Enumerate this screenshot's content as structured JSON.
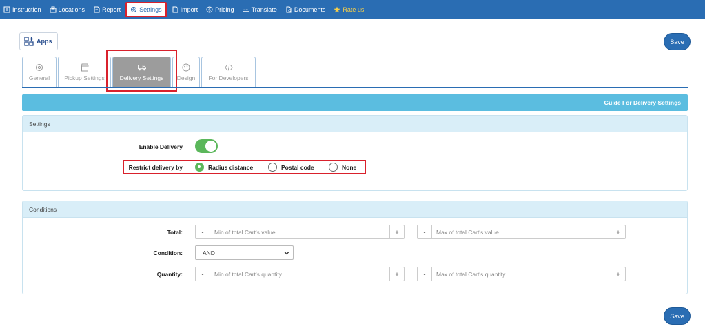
{
  "nav": {
    "items": [
      {
        "label": "Instruction",
        "icon": "instruction-icon"
      },
      {
        "label": "Locations",
        "icon": "locations-icon"
      },
      {
        "label": "Report",
        "icon": "report-icon"
      },
      {
        "label": "Settings",
        "icon": "gear-icon"
      },
      {
        "label": "Import",
        "icon": "import-icon"
      },
      {
        "label": "Pricing",
        "icon": "pricing-icon"
      },
      {
        "label": "Translate",
        "icon": "translate-icon"
      },
      {
        "label": "Documents",
        "icon": "documents-icon"
      },
      {
        "label": "Rate us",
        "icon": "star-icon"
      }
    ]
  },
  "apps_label": "Apps",
  "save_label": "Save",
  "tabs": [
    {
      "label": "General",
      "icon": "gear-icon"
    },
    {
      "label": "Pickup Settings",
      "icon": "store-icon"
    },
    {
      "label": "Delivery Settings",
      "icon": "truck-icon"
    },
    {
      "label": "Design",
      "icon": "palette-icon"
    },
    {
      "label": "For Developers",
      "icon": "code-icon"
    }
  ],
  "guide_label": "Guide For Delivery Settings",
  "settings": {
    "title": "Settings",
    "enable_label": "Enable Delivery",
    "enable_value": true,
    "restrict_label": "Restrict delivery by",
    "options": [
      "Radius distance",
      "Postal code",
      "None"
    ],
    "selected": "Radius distance"
  },
  "conditions": {
    "title": "Conditions",
    "total_label": "Total:",
    "total_min_placeholder": "Min of total Cart's value",
    "total_max_placeholder": "Max of total Cart's value",
    "condition_label": "Condition:",
    "condition_value": "AND",
    "quantity_label": "Quantity:",
    "quantity_min_placeholder": "Min of total Cart's quantity",
    "quantity_max_placeholder": "Max of total Cart's quantity",
    "minus": "-",
    "plus": "+"
  },
  "colors": {
    "nav_bg": "#2a6db3",
    "accent": "#5bb75b",
    "guide_bg": "#5bbde0",
    "highlight": "#d9212c"
  }
}
